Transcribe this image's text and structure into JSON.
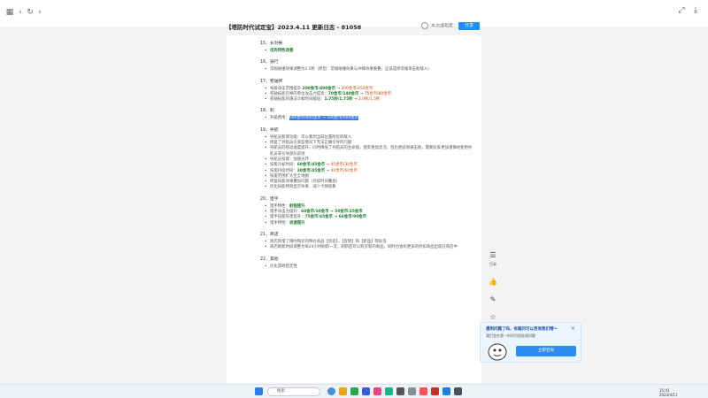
{
  "browser": {
    "back_icon": "back-arrow",
    "forward_icon": "forward-arrow",
    "refresh_icon": "refresh",
    "grid_icon": "grid"
  },
  "doc": {
    "title": "【塔防时代试定宝】2023.4.11 更新日志 - 81058",
    "collab_text": "本次编辑者：1",
    "share_label": "分享"
  },
  "sections": [
    {
      "heading": "15、长剑男",
      "items": [
        {
          "segments": [
            {
              "t": "坦克特性改善",
              "c": "b"
            }
          ]
        }
      ]
    },
    {
      "heading": "16、骑行",
      "items": [
        {
          "segments": [
            {
              "t": "常规碰撞效果调整为2.5秒（原因：常规碰撞效果与冲锋效果重叠，应该选择常规来击败敌人）",
              "c": ""
            }
          ]
        }
      ]
    },
    {
      "heading": "17、卷轴师",
      "items": [
        {
          "segments": [
            {
              "t": "每级攻击范围提升 ",
              "c": ""
            },
            {
              "t": "200金币/400金币",
              "c": "b"
            },
            {
              "t": " → ",
              "c": ""
            },
            {
              "t": "300金币/450金币",
              "c": "r"
            }
          ]
        },
        {
          "segments": [
            {
              "t": "卷轴技能召唤的单位攻击力提高：",
              "c": ""
            },
            {
              "t": "70金币/140金币",
              "c": "b"
            },
            {
              "t": " → ",
              "c": ""
            },
            {
              "t": "75金币/80金币",
              "c": "r"
            }
          ]
        },
        {
          "segments": [
            {
              "t": "卷轴技能的施法冷却时间缩短：",
              "c": ""
            },
            {
              "t": "1.75秒/1.75秒",
              "c": "b"
            },
            {
              "t": " → ",
              "c": ""
            },
            {
              "t": "2.0秒/1.5秒",
              "c": "r"
            }
          ]
        }
      ]
    },
    {
      "heading": "18、刺",
      "items": [
        {
          "segments": [
            {
              "t": "升级费用：",
              "c": ""
            },
            {
              "t": "600金币/600金币 → 500金币/600金币",
              "c": "sel"
            }
          ]
        }
      ]
    },
    {
      "heading": "19、导航",
      "items": [
        {
          "segments": [
            {
              "t": "导航员新增功能：可以看到当前位置附近的敌人",
              "c": ""
            }
          ]
        },
        {
          "segments": [
            {
              "t": "修复了导航员在某些情况下无法正确引导的问题",
              "c": ""
            }
          ]
        },
        {
          "segments": [
            {
              "t": "导航员的移动速度提升，同时降低了导航员的生命值，使其更加灵活，但也更容易被击败，需要玩家更加谨慎地使用导航员来引导部队前进",
              "c": ""
            }
          ]
        },
        {
          "segments": [
            {
              "t": "导航员技能：加速光环",
              "c": ""
            }
          ]
        },
        {
          "segments": [
            {
              "t": "技能冷却时间：",
              "c": ""
            },
            {
              "t": "60金币/45金币",
              "c": "b"
            },
            {
              "t": " → ",
              "c": ""
            },
            {
              "t": "45金币/30金币",
              "c": "r"
            }
          ]
        },
        {
          "segments": [
            {
              "t": "技能持续时间：",
              "c": ""
            },
            {
              "t": "30金币/45金币",
              "c": "b"
            },
            {
              "t": " → ",
              "c": ""
            },
            {
              "t": "40金币/60金币",
              "c": "r"
            }
          ]
        },
        {
          "segments": [
            {
              "t": "技能范围扩大至全地图",
              "c": ""
            }
          ]
        },
        {
          "segments": [
            {
              "t": "修复技能效果叠加问题（持续时间叠加）",
              "c": ""
            }
          ]
        },
        {
          "segments": [
            {
              "t": "优化技能特效显示效果，减少卡顿现象",
              "c": ""
            }
          ]
        }
      ]
    },
    {
      "heading": "20、猎手",
      "items": [
        {
          "segments": [
            {
              "t": "猎手特性：",
              "c": ""
            },
            {
              "t": "射程提升",
              "c": "b"
            }
          ]
        },
        {
          "segments": [
            {
              "t": "猎手攻击力提升：",
              "c": ""
            },
            {
              "t": "60金币/30金币 → 50金币/25金币",
              "c": "b"
            }
          ]
        },
        {
          "segments": [
            {
              "t": "猎手技能伤害提升：",
              "c": ""
            },
            {
              "t": "75金币/45金币 → 66金币/90金币",
              "c": "b"
            }
          ]
        },
        {
          "segments": [
            {
              "t": "猎手特性：",
              "c": ""
            },
            {
              "t": "攻速提升",
              "c": "b"
            }
          ]
        }
      ]
    },
    {
      "heading": "21、商店",
      "items": [
        {
          "segments": [
            {
              "t": "商店新增了限时购买的特价商品【热卖】，【促销】和【新品】等标签",
              "c": ""
            }
          ]
        },
        {
          "segments": [
            {
              "t": "商店刷新时间调整为每24小时刷新一次，刷新后可以购买新的商品，同时也会有更多的折扣商品出现在商店中",
              "c": ""
            }
          ]
        }
      ]
    },
    {
      "heading": "22、其他",
      "items": [
        {
          "segments": [
            {
              "t": "优化游戏稳定性",
              "c": ""
            }
          ]
        }
      ]
    }
  ],
  "tools": [
    {
      "name": "outline-tool",
      "glyph": "☰",
      "label": "目录"
    },
    {
      "name": "like-tool",
      "glyph": "👍",
      "label": ""
    },
    {
      "name": "comment-tool",
      "glyph": "✎",
      "label": ""
    },
    {
      "name": "star-tool",
      "glyph": "☆",
      "label": ""
    }
  ],
  "popup": {
    "title": "遇到问题了吗，有疑问可以咨询我们哦～",
    "subtitle": "我们会在第一时间为您处理问题",
    "button_label": "立即咨询",
    "close_glyph": "×"
  },
  "taskbar": {
    "search_placeholder": "搜索",
    "time": "15:41",
    "date": "2023/4/11"
  }
}
